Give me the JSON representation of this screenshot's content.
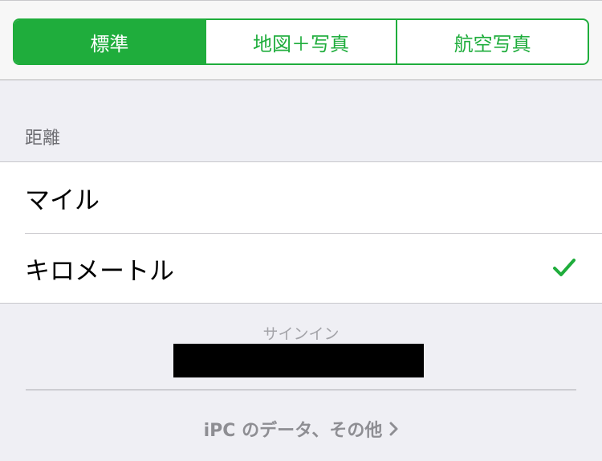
{
  "map_type": {
    "segments": [
      "標準",
      "地図＋写真",
      "航空写真"
    ],
    "selected_index": 0
  },
  "distance": {
    "header": "距離",
    "options": [
      {
        "label": "マイル",
        "checked": false
      },
      {
        "label": "キロメートル",
        "checked": true
      }
    ]
  },
  "footer": {
    "signin_label": "サインイン",
    "link_label": "iPC のデータ、その他"
  },
  "colors": {
    "accent": "#1fad3c",
    "background": "#efeff4",
    "secondary_text": "#8e8e93"
  },
  "icons": {
    "check": "checkmark-icon",
    "chevron": "chevron-right-icon"
  }
}
